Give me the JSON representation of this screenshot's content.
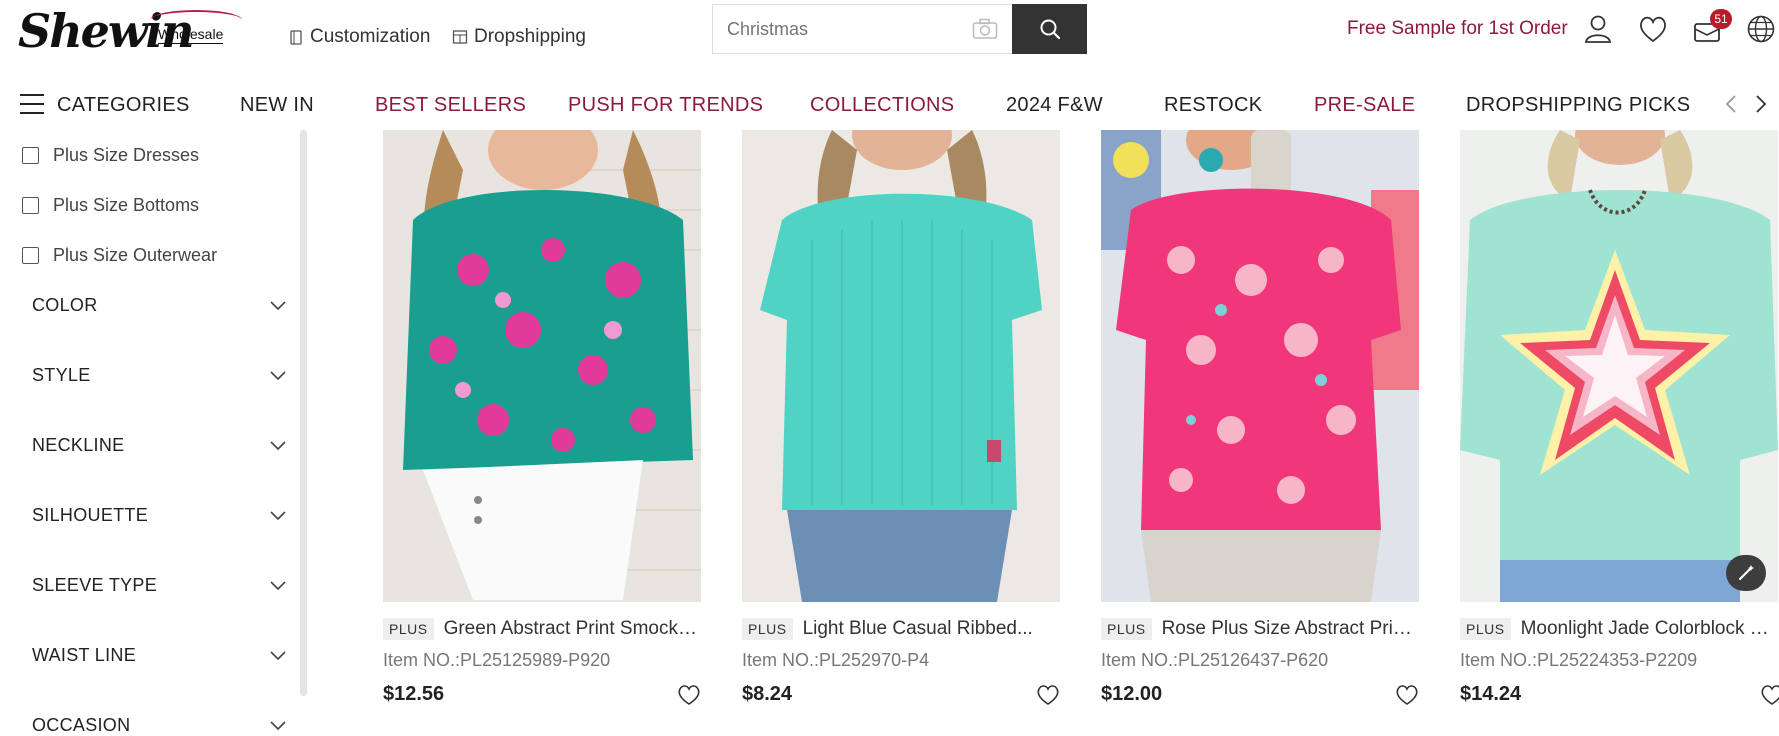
{
  "header": {
    "logo_text": "Shewin",
    "logo_sub": "Wholesale",
    "links": [
      {
        "label": "Customization"
      },
      {
        "label": "Dropshipping"
      }
    ],
    "search": {
      "placeholder": "Christmas"
    },
    "free_sample": "Free Sample for 1st Order",
    "cart_count": "51",
    "accent_color": "#8b1a3b"
  },
  "nav": {
    "categories_label": "CATEGORIES",
    "items": [
      {
        "label": "NEW IN"
      },
      {
        "label": "BEST SELLERS"
      },
      {
        "label": "PUSH FOR TRENDS"
      },
      {
        "label": "COLLECTIONS"
      },
      {
        "label": "2024 F&W"
      },
      {
        "label": "RESTOCK"
      },
      {
        "label": "PRE-SALE"
      },
      {
        "label": "DROPSHIPPING PICKS"
      }
    ]
  },
  "sidebar": {
    "checkboxes": [
      {
        "label": "Plus Size Dresses"
      },
      {
        "label": "Plus Size Bottoms"
      },
      {
        "label": "Plus Size Outerwear"
      }
    ],
    "filters": [
      {
        "label": "COLOR"
      },
      {
        "label": "STYLE"
      },
      {
        "label": "NECKLINE"
      },
      {
        "label": "SILHOUETTE"
      },
      {
        "label": "SLEEVE TYPE"
      },
      {
        "label": "WAIST LINE"
      },
      {
        "label": "OCCASION"
      }
    ]
  },
  "products": [
    {
      "tag": "PLUS",
      "title": "Green Abstract Print Smocked...",
      "item_no": "Item NO.:PL25125989-P920",
      "price": "$12.56"
    },
    {
      "tag": "PLUS",
      "title": "Light Blue Casual Ribbed...",
      "item_no": "Item NO.:PL252970-P4",
      "price": "$8.24"
    },
    {
      "tag": "PLUS",
      "title": "Rose Plus Size Abstract Print...",
      "item_no": "Item NO.:PL25126437-P620",
      "price": "$12.00"
    },
    {
      "tag": "PLUS",
      "title": "Moonlight Jade Colorblock Sta...",
      "item_no": "Item NO.:PL25224353-P2209",
      "price": "$14.24"
    }
  ]
}
